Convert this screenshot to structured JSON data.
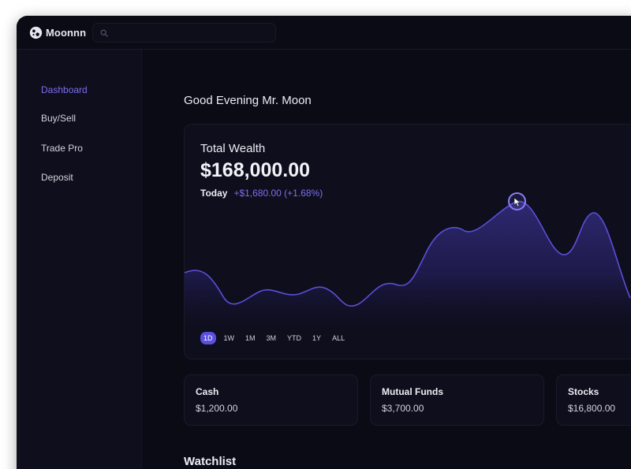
{
  "app": {
    "name": "Moonnn",
    "logo_icon": "moon-crater-icon"
  },
  "search": {
    "placeholder": "",
    "icon": "search-icon"
  },
  "sidebar": {
    "items": [
      {
        "label": "Dashboard",
        "active": true
      },
      {
        "label": "Buy/Sell",
        "active": false
      },
      {
        "label": "Trade Pro",
        "active": false
      },
      {
        "label": "Deposit",
        "active": false
      }
    ]
  },
  "main": {
    "greeting": "Good Evening Mr. Moon",
    "wealth": {
      "label": "Total Wealth",
      "value": "$168,000.00",
      "today_label": "Today",
      "today_change": "+$1,680.00 (+1.68%)"
    },
    "ranges": [
      {
        "label": "1D",
        "active": true
      },
      {
        "label": "1W",
        "active": false
      },
      {
        "label": "1M",
        "active": false
      },
      {
        "label": "3M",
        "active": false
      },
      {
        "label": "YTD",
        "active": false
      },
      {
        "label": "1Y",
        "active": false
      },
      {
        "label": "ALL",
        "active": false
      }
    ],
    "assets": [
      {
        "name": "Cash",
        "value": "$1,200.00"
      },
      {
        "name": "Mutual Funds",
        "value": "$3,700.00"
      },
      {
        "name": "Stocks",
        "value": "$16,800.00"
      }
    ],
    "watchlist_title": "Watchlist"
  },
  "colors": {
    "background": "#0b0b15",
    "sidebar": "#0e0e1c",
    "accent": "#7c6ff0",
    "accent_active_bg": "#5b4fe0",
    "text": "#ececf4"
  }
}
